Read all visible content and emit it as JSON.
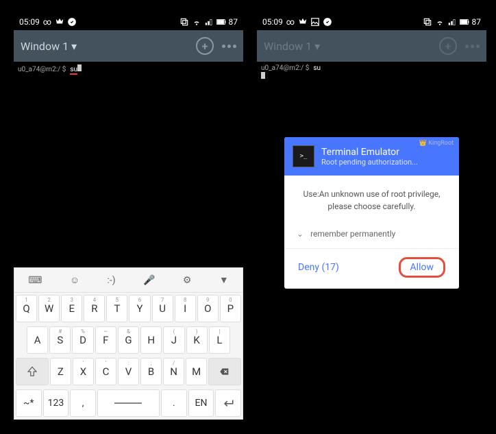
{
  "status": {
    "time": "05:09",
    "battery": "87",
    "icons_left": [
      "infinity",
      "crown",
      "check"
    ],
    "icons_right": [
      "copy",
      "wifi",
      "signal",
      "battery"
    ]
  },
  "window": {
    "title": "Window 1"
  },
  "terminal": {
    "prompt": "u0_a74@m2:/ $",
    "cmd": "su"
  },
  "status2": {
    "time": "05:09",
    "battery": "87"
  },
  "window2": {
    "title": "Window 1"
  },
  "terminal2": {
    "prompt": "u0_a74@m2:/ $",
    "cmd": "su"
  },
  "dialog": {
    "brand": "KingRoot",
    "title": "Terminal Emulator",
    "subtitle": "Root pending authorization...",
    "body1": "Use:An unknown use of root privilege,",
    "body2": "please choose carefully.",
    "remember": "remember permanently",
    "deny": "Deny (17)",
    "allow": "Allow"
  },
  "keyboard": {
    "toprow": [
      "⌨",
      "☺",
      ":-)",
      "🎤",
      "⚙",
      "▼"
    ],
    "row1": [
      {
        "m": "Q",
        "s": "1"
      },
      {
        "m": "W",
        "s": "2"
      },
      {
        "m": "E",
        "s": "3"
      },
      {
        "m": "R",
        "s": "4"
      },
      {
        "m": "T",
        "s": "5"
      },
      {
        "m": "Y",
        "s": "6"
      },
      {
        "m": "U",
        "s": "7"
      },
      {
        "m": "I",
        "s": "8"
      },
      {
        "m": "O",
        "s": "9"
      },
      {
        "m": "P",
        "s": "0"
      }
    ],
    "row2": [
      {
        "m": "A",
        "s": ""
      },
      {
        "m": "S",
        "s": "#"
      },
      {
        "m": "D",
        "s": "%"
      },
      {
        "m": "F",
        "s": "~"
      },
      {
        "m": "G",
        "s": "&"
      },
      {
        "m": "H",
        "s": ""
      },
      {
        "m": "J",
        "s": "("
      },
      {
        "m": "K",
        "s": ")"
      },
      {
        "m": "L",
        "s": "|"
      }
    ],
    "row3": [
      {
        "m": "Z",
        "s": ""
      },
      {
        "m": "X",
        "s": "'"
      },
      {
        "m": "C",
        "s": "'"
      },
      {
        "m": "V",
        "s": ":"
      },
      {
        "m": "B",
        "s": ";"
      },
      {
        "m": "N",
        "s": "/"
      },
      {
        "m": "M",
        "s": ""
      }
    ],
    "row4": {
      "sym": "~*",
      "num": "123",
      "comma": ",",
      "dot": ".",
      "lang": "EN"
    }
  }
}
